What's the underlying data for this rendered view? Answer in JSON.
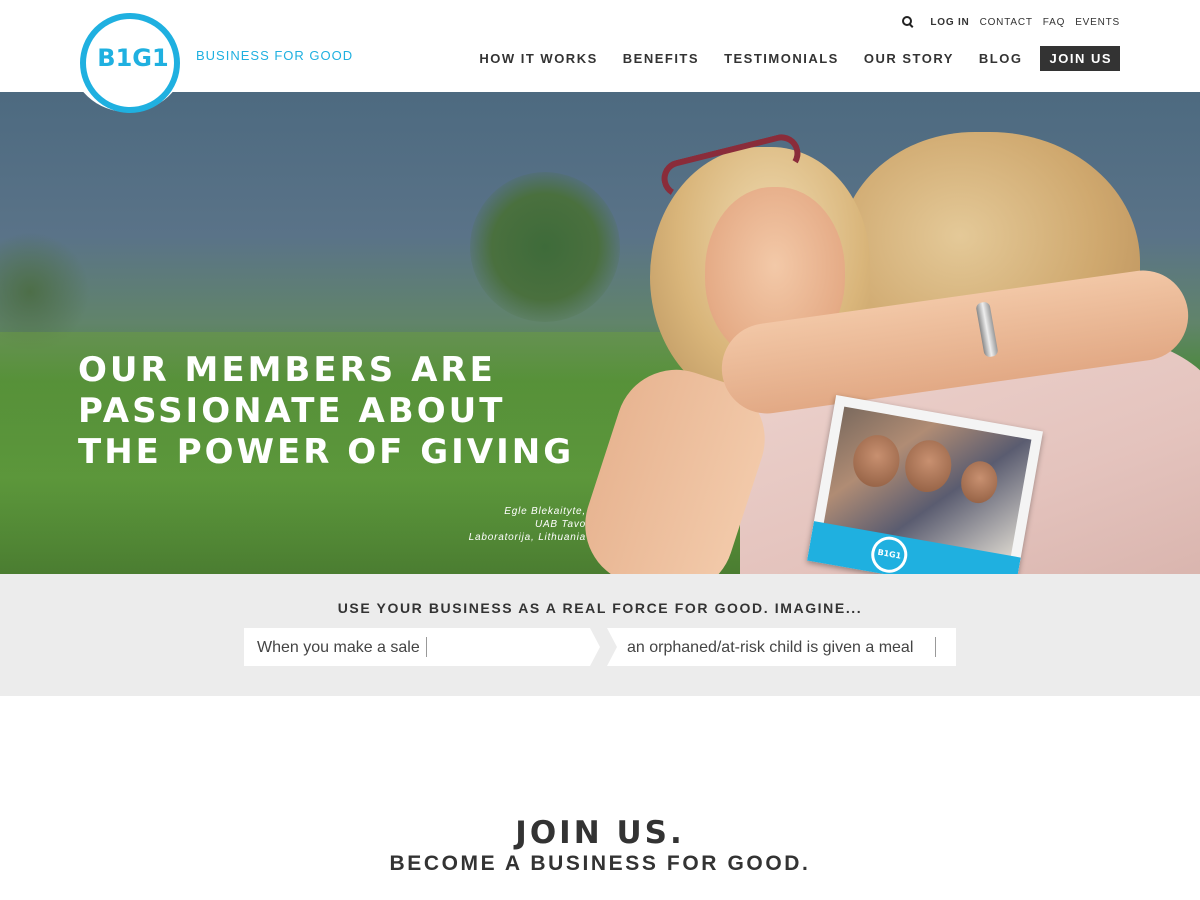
{
  "brand": {
    "logo_text": "B1G1",
    "tagline": "BUSINESS FOR GOOD",
    "accent_color": "#1fb0e0",
    "dark_color": "#333333"
  },
  "utility_nav": {
    "search_icon": "search-icon",
    "items": [
      "LOG IN",
      "CONTACT",
      "FAQ",
      "EVENTS"
    ]
  },
  "main_nav": {
    "items": [
      "HOW IT WORKS",
      "BENEFITS",
      "TESTIMONIALS",
      "OUR STORY",
      "BLOG"
    ],
    "cta": "JOIN US"
  },
  "hero": {
    "headline": [
      "OUR MEMBERS ARE",
      "PASSIONATE ABOUT",
      "THE POWER OF GIVING"
    ],
    "caption": [
      "Egle Blekaityte,",
      "UAB Tavo",
      "Laboratorija, Lithuania"
    ],
    "card_logo": "B1G1"
  },
  "imagine": {
    "title": "USE YOUR BUSINESS AS A REAL FORCE FOR GOOD. IMAGINE...",
    "when_value": "When you make a sale",
    "result_value": "an orphaned/at-risk child is given a meal"
  },
  "join": {
    "title": "JOIN US.",
    "subtitle": "BECOME A BUSINESS FOR GOOD."
  }
}
